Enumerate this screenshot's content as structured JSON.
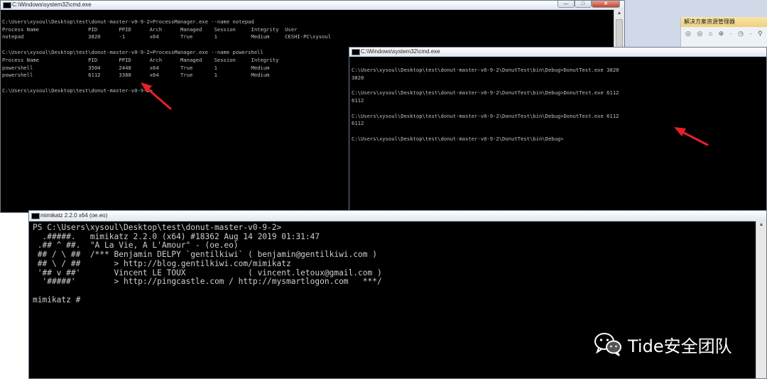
{
  "colors": {
    "console_bg": "#000000",
    "console_fg": "#c0c0c0",
    "arrow": "#e8202a",
    "watermark": "#ffffff"
  },
  "cmd_window_1": {
    "title": "C:\\Windows\\system32\\cmd.exe",
    "lines": [
      "",
      "C:\\Users\\xysoul\\Desktop\\test\\donut-master-v0-9-2>ProcessManager.exe --name notepad",
      "Process Name                PID       PPID      Arch      Managed    Session     Integrity  User",
      "notepad                     3820      -1        x64       True       1           Medium     CESHI-PC\\xysoul",
      "",
      "C:\\Users\\xysoul\\Desktop\\test\\donut-master-v0-9-2>ProcessManager.exe --name powershell",
      "Process Name                PID       PPID      Arch      Managed    Session     Integrity",
      "powershell                  3504      2448      x64       True       1           Medium",
      "powershell                  6112      3388      x64       True       1           Medium",
      "",
      "C:\\Users\\xysoul\\Desktop\\test\\donut-master-v0-9-2>"
    ]
  },
  "cmd_window_2": {
    "title": "C:\\Windows\\system32\\cmd.exe",
    "lines": [
      "",
      "C:\\Users\\xysoul\\Desktop\\test\\donut-master-v0-9-2\\DonutTest\\bin\\Debug>DonutTest.exe 3820",
      "3820",
      "",
      "C:\\Users\\xysoul\\Desktop\\test\\donut-master-v0-9-2\\DonutTest\\bin\\Debug>DonutTest.exe 6112",
      "6112",
      "",
      "C:\\Users\\xysoul\\Desktop\\test\\donut-master-v0-9-2\\DonutTest\\bin\\Debug>DonutTest.exe 6112",
      "6112",
      "",
      "C:\\Users\\xysoul\\Desktop\\test\\donut-master-v0-9-2\\DonutTest\\bin\\Debug>"
    ]
  },
  "mimikatz_window": {
    "title": "mimikatz 2.2.0 x64 (oe.eo)",
    "lines": [
      "PS C:\\Users\\xysoul\\Desktop\\test\\donut-master-v0-9-2>",
      "  .#####.   mimikatz 2.2.0 (x64) #18362 Aug 14 2019 01:31:47",
      " .## ^ ##.  \"A La Vie, A L'Amour\" - (oe.eo)",
      " ## / \\ ##  /*** Benjamin DELPY `gentilkiwi` ( benjamin@gentilkiwi.com )",
      " ## \\ / ##       > http://blog.gentilkiwi.com/mimikatz",
      " '## v ##'       Vincent LE TOUX             ( vincent.letoux@gmail.com )",
      "  '#####'        > http://pingcastle.com / http://mysmartlogon.com   ***/",
      "",
      "mimikatz #"
    ]
  },
  "vs_panel": {
    "header": "解决方案资源管理器",
    "tools": "◎ ◎ ⌂ ⊕ · ◷ · ⚲"
  },
  "window_controls": {
    "minimize": "—",
    "maximize": "□",
    "close": "✕"
  },
  "watermark": {
    "text": "Tide安全团队",
    "icon": "wechat-icon"
  }
}
